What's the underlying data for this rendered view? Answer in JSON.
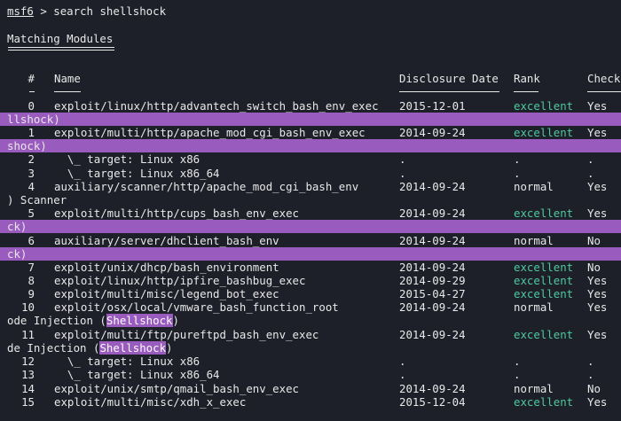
{
  "prompt": {
    "host": "msf6",
    "symbol": ">",
    "command": "search shellshock"
  },
  "heading": "Matching Modules",
  "columns": {
    "id": "#",
    "name": "Name",
    "date": "Disclosure Date",
    "rank": "Rank",
    "check": "Check"
  },
  "rows": [
    {
      "id": "0",
      "name": "exploit/linux/http/advantech_switch_bash_env_exec",
      "date": "2015-12-01",
      "rank": "excellent",
      "check": "Yes"
    },
    {
      "id": "1",
      "name": "exploit/multi/http/apache_mod_cgi_bash_env_exec",
      "date": "2014-09-24",
      "rank": "excellent",
      "check": "Yes"
    },
    {
      "id": "2",
      "name": "  \\_ target: Linux x86",
      "date": ".",
      "rank": ".",
      "check": "."
    },
    {
      "id": "3",
      "name": "  \\_ target: Linux x86_64",
      "date": ".",
      "rank": ".",
      "check": "."
    },
    {
      "id": "4",
      "name": "auxiliary/scanner/http/apache_mod_cgi_bash_env",
      "date": "2014-09-24",
      "rank": "normal",
      "check": "Yes"
    },
    {
      "id": "5",
      "name": "exploit/multi/http/cups_bash_env_exec",
      "date": "2014-09-24",
      "rank": "excellent",
      "check": "Yes"
    },
    {
      "id": "6",
      "name": "auxiliary/server/dhclient_bash_env",
      "date": "2014-09-24",
      "rank": "normal",
      "check": "No"
    },
    {
      "id": "7",
      "name": "exploit/unix/dhcp/bash_environment",
      "date": "2014-09-24",
      "rank": "excellent",
      "check": "No"
    },
    {
      "id": "8",
      "name": "exploit/linux/http/ipfire_bashbug_exec",
      "date": "2014-09-29",
      "rank": "excellent",
      "check": "Yes"
    },
    {
      "id": "9",
      "name": "exploit/multi/misc/legend_bot_exec",
      "date": "2015-04-27",
      "rank": "excellent",
      "check": "Yes"
    },
    {
      "id": "10",
      "name": "exploit/osx/local/vmware_bash_function_root",
      "date": "2014-09-24",
      "rank": "normal",
      "check": "Yes"
    },
    {
      "id": "11",
      "name": "exploit/multi/ftp/pureftpd_bash_env_exec",
      "date": "2014-09-24",
      "rank": "excellent",
      "check": "Yes"
    },
    {
      "id": "12",
      "name": "  \\_ target: Linux x86",
      "date": ".",
      "rank": ".",
      "check": "."
    },
    {
      "id": "13",
      "name": "  \\_ target: Linux x86_64",
      "date": ".",
      "rank": ".",
      "check": "."
    },
    {
      "id": "14",
      "name": "exploit/unix/smtp/qmail_bash_env_exec",
      "date": "2014-09-24",
      "rank": "normal",
      "check": "No"
    },
    {
      "id": "15",
      "name": "exploit/multi/misc/xdh_x_exec",
      "date": "2015-12-04",
      "rank": "excellent",
      "check": "Yes"
    }
  ],
  "wraps": {
    "w0": {
      "text": "llshock)"
    },
    "w1": {
      "text": "shock)"
    },
    "w4": {
      "text": ") Scanner"
    },
    "w5": {
      "text": "ck)"
    },
    "w6": {
      "text": "ck)"
    },
    "w10": {
      "pre": "ode Injection (",
      "hl": "Shellshock",
      "post": ")"
    },
    "w11": {
      "pre": "de Injection (",
      "hl": "Shellshock",
      "post": ")"
    }
  },
  "colors": {
    "background": "#1e2029",
    "text": "#e8e8e8",
    "excellent": "#4ec9a0",
    "highlight": "#9a5bbf"
  }
}
